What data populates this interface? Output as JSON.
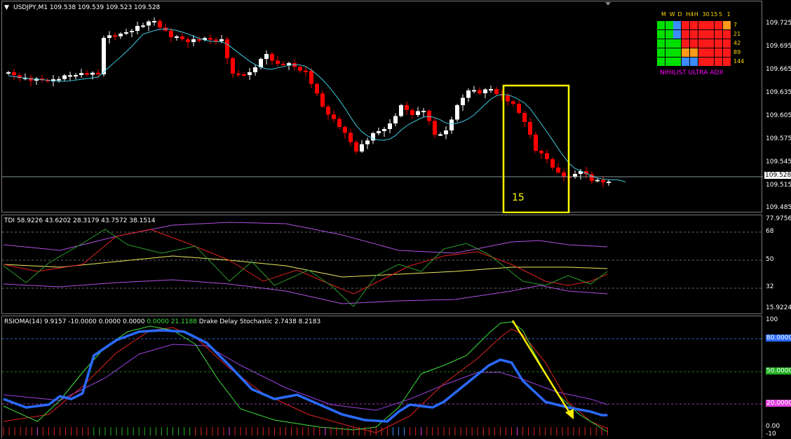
{
  "price_header": "USDJPY,M1  109.538 109.539 109.523 109.528",
  "tdi_header": "TDI 58.9226 43.6202 28.3179 43.7572 38.1514",
  "rsi_header_a": "RSIOMA(14) 9.9157 -10.0000 0.0000 0.0000 ",
  "rsi_header_b": "0.0000 21.1188",
  "rsi_header_c": "  Drake Delay Stochastic 2.7438 8.2183",
  "box_label": "15",
  "current_price": "109.528",
  "price_axis": [
    "109.725",
    "109.695",
    "109.665",
    "109.635",
    "109.605",
    "109.575",
    "109.545",
    "109.515",
    "109.485"
  ],
  "tdi_axis": [
    "77.9756",
    "68",
    "50",
    "32",
    "15.9224"
  ],
  "rsi_axis": [
    "100",
    "80.0000",
    "50.0000",
    "20.0000",
    "0.00",
    "-10"
  ],
  "nihilist": {
    "title": "NIHILIST ULTRA ADX",
    "timeframes": [
      "M",
      "W",
      "D",
      "H4",
      "H",
      "30",
      "15",
      "5",
      "1"
    ],
    "periods": [
      "7",
      "21",
      "42",
      "89",
      "144"
    ],
    "colors": {
      "green": "#00e000",
      "red": "#ff1a1a",
      "blue": "#3a8cff",
      "orange": "#ff9a1a"
    },
    "grid": [
      [
        "green",
        "green",
        "blue",
        "red",
        "red",
        "red",
        "red",
        "red",
        "orange"
      ],
      [
        "green",
        "green",
        "blue",
        "red",
        "red",
        "red",
        "red",
        "red",
        "red"
      ],
      [
        "green",
        "green",
        "green",
        "red",
        "red",
        "red",
        "red",
        "red",
        "red"
      ],
      [
        "green",
        "green",
        "green",
        "orange",
        "orange",
        "red",
        "red",
        "red",
        "red"
      ],
      [
        "green",
        "green",
        "green",
        "blue",
        "blue",
        "red",
        "red",
        "red",
        "red"
      ]
    ]
  },
  "colors": {
    "bull": "#ffffff",
    "bear": "#ff0000",
    "ma": "#40c8e0",
    "box": "#ffff00",
    "tdi_band": "#b050e0",
    "tdi_mid": "#e8e860",
    "tdi_fast": "#2a9a2a",
    "tdi_slow": "#e02020",
    "rsi_main": "#2a6aff",
    "rsi_green": "#40e040",
    "rsi_red": "#e02020",
    "rsi_violet": "#9a40e0",
    "level80": "#3a8cff",
    "level50": "#20b020",
    "level20": "#e040e0",
    "arrow": "#ffee00"
  }
}
